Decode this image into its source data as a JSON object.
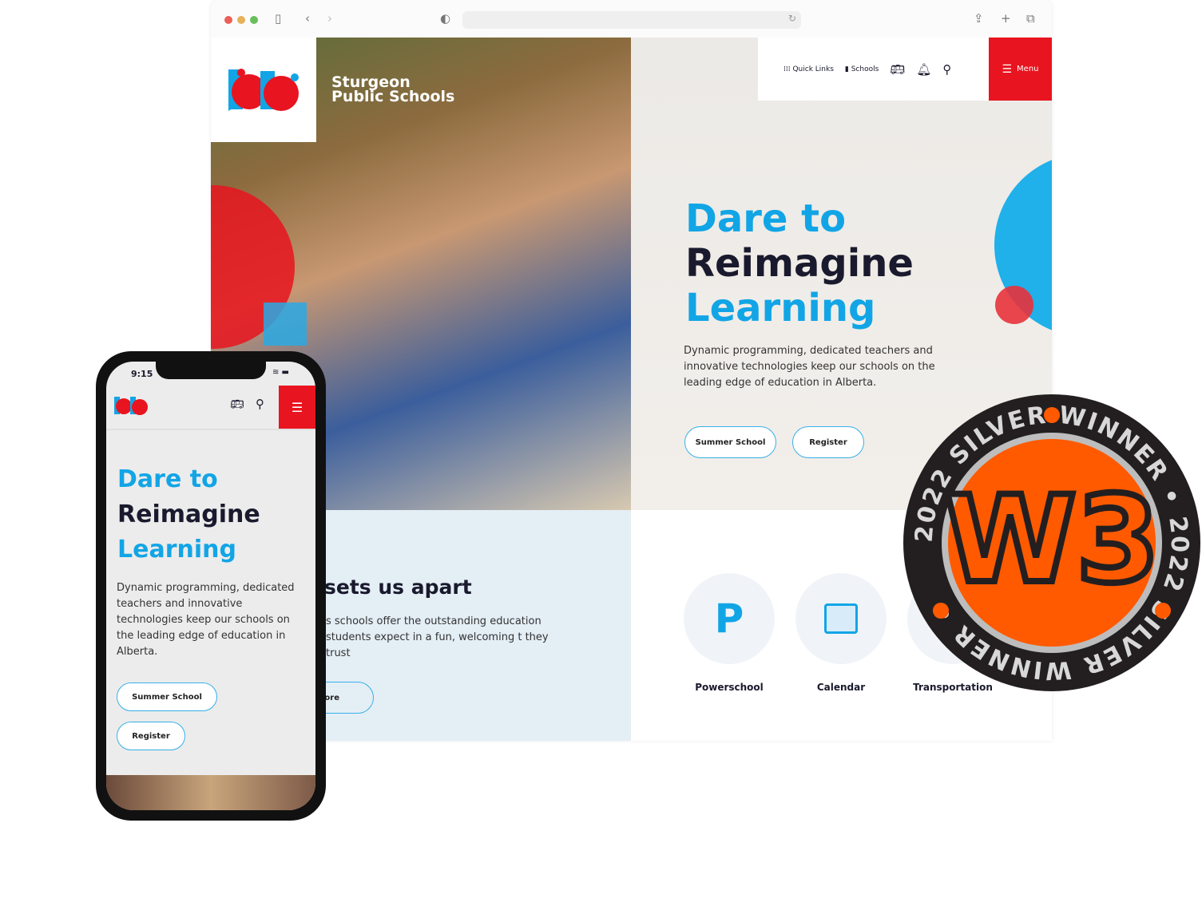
{
  "browser": {
    "icons": [
      "sidebar-icon",
      "back-icon",
      "forward-icon",
      "shield-icon",
      "reload-icon",
      "share-icon",
      "new-tab-icon",
      "tabs-icon"
    ]
  },
  "site": {
    "name_line1": "Sturgeon",
    "name_line2": "Public Schools",
    "nav": {
      "quick_links": "Quick Links",
      "schools": "Schools",
      "menu": "Menu"
    },
    "hero": {
      "line1": "Dare to",
      "line2": "Reimagine",
      "line3": "Learning",
      "desc": "Dynamic programming, dedicated teachers and innovative technologies keep our schools on the leading edge of education in Alberta.",
      "btn1": "Summer School",
      "btn2": "Register"
    },
    "apart": {
      "title": "sets us apart",
      "text": "s schools offer the outstanding education students expect in a fun, welcoming t they trust",
      "btn": "lore"
    },
    "quick_links": [
      {
        "label": "Powerschool"
      },
      {
        "label": "Calendar"
      },
      {
        "label": "Transportation"
      }
    ]
  },
  "phone": {
    "time": "9:15",
    "desc": "Dynamic programming, dedicated teachers and innovative technologies keep our schools on the leading edge of education in Alberta."
  },
  "badge": {
    "text": "2022 SILVER WINNER",
    "logo": "W3"
  },
  "colors": {
    "blue": "#12a5e6",
    "red": "#e8141f",
    "navy": "#1a1a2e",
    "orange": "#ff5a00"
  }
}
